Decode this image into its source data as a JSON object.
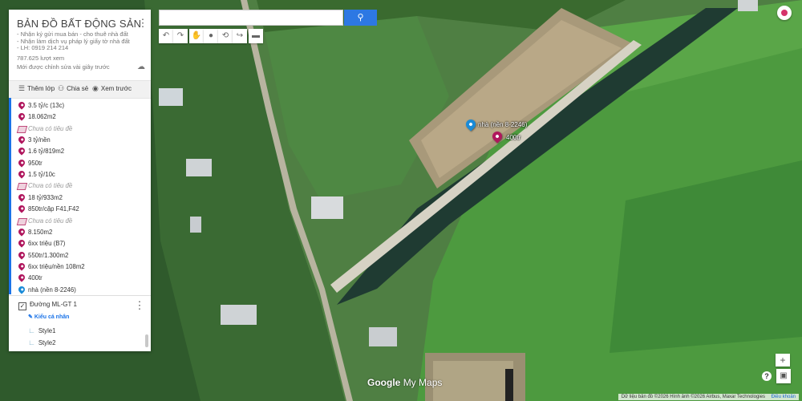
{
  "colors": {
    "accent": "#1a73e8",
    "marker_red": "#b0165d",
    "marker_blue": "#1a8bd8",
    "search_button": "#2d78e3"
  },
  "panel": {
    "title": "BẢN ĐỒ BẤT ĐỘNG SẢN",
    "description": [
      "- Nhận ký gửi mua bán - cho thuê nhà đất",
      "- Nhận làm dịch vụ pháp lý giấy tờ nhà đất",
      "- LH: 0919 214 214"
    ],
    "views": "787.625 lượt xem",
    "edit_note": "Mới được chỉnh sửa vài giây trước",
    "toolbar": {
      "add_layer": "Thêm lớp",
      "share": "Chia sẻ",
      "preview": "Xem trước"
    },
    "items": [
      {
        "label": "3.5 tỷ/c (13c)",
        "type": "marker"
      },
      {
        "label": "18.062m2",
        "type": "marker"
      },
      {
        "label": "Chưa có tiêu đề",
        "type": "polygon"
      },
      {
        "label": "3 tỷ/nền",
        "type": "marker"
      },
      {
        "label": "1.6 tỷ/819m2",
        "type": "marker"
      },
      {
        "label": "950tr",
        "type": "marker"
      },
      {
        "label": "1.5 tỷ/10c",
        "type": "marker"
      },
      {
        "label": "Chưa có tiêu đề",
        "type": "polygon"
      },
      {
        "label": "18 tỷ/933m2",
        "type": "marker"
      },
      {
        "label": "850tr/cặp F41,F42",
        "type": "marker"
      },
      {
        "label": "Chưa có tiêu đề",
        "type": "polygon"
      },
      {
        "label": "8.150m2",
        "type": "marker"
      },
      {
        "label": "6xx triệu (B7)",
        "type": "marker"
      },
      {
        "label": "550tr/1.300m2",
        "type": "marker"
      },
      {
        "label": "6xx triệu/nền 108m2",
        "type": "marker"
      },
      {
        "label": "400tr",
        "type": "marker"
      },
      {
        "label": "nhà (nền 8-2246)",
        "type": "marker-blue"
      }
    ],
    "layer2": {
      "checkbox": "✓",
      "name": "Đường ML-GT 1",
      "style_link": "Kiểu cá nhân",
      "styles": [
        "Style1",
        "Style2"
      ]
    }
  },
  "search": {
    "placeholder": ""
  },
  "map_markers": {
    "blue": {
      "label": "nhà (nền 8-2246)"
    },
    "red": {
      "label": "400tr"
    }
  },
  "map_controls": {
    "zoom_in": "+",
    "zoom_out": "−",
    "help": "?"
  },
  "logo": {
    "google": "Google",
    "my_maps": "My Maps"
  },
  "attribution": {
    "text": "Dữ liệu bản đồ ©2026 Hình ảnh ©2026 Airbus, Maxar Technologies",
    "terms": "Điều khoản"
  }
}
